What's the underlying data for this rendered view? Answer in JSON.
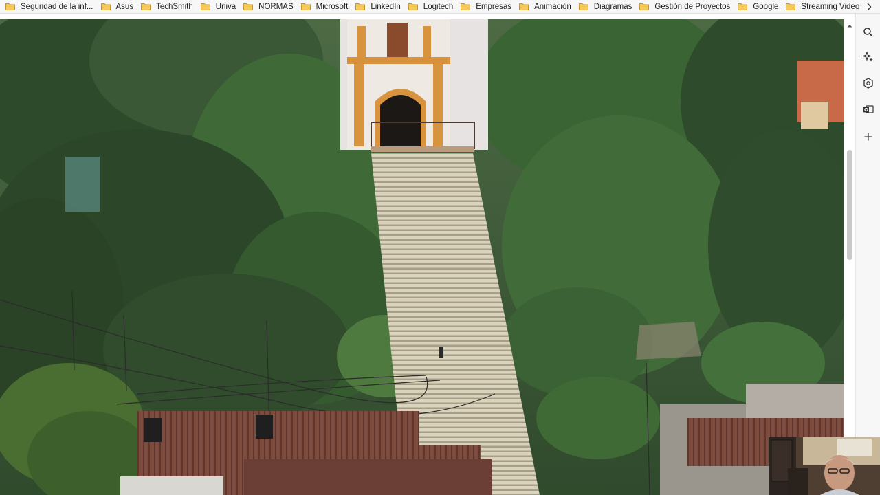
{
  "bookmarks": [
    {
      "label": "Seguridad de la inf..."
    },
    {
      "label": "Asus"
    },
    {
      "label": "TechSmith"
    },
    {
      "label": "Univa"
    },
    {
      "label": "NORMAS"
    },
    {
      "label": "Microsoft"
    },
    {
      "label": "LinkedIn"
    },
    {
      "label": "Logitech"
    },
    {
      "label": "Empresas"
    },
    {
      "label": "Animación"
    },
    {
      "label": "Diagramas"
    },
    {
      "label": "Gestión de Proyectos"
    },
    {
      "label": "Google"
    },
    {
      "label": "Streaming Video"
    }
  ],
  "bookmarks_overflow_icon": "chevron-right-icon",
  "side_panel_icons": [
    "search-icon",
    "sparkle-icon",
    "copilot-icon",
    "outlook-icon",
    "add-icon"
  ],
  "colors": {
    "folder": "#e8b64a",
    "bar_bg": "#f7f7f7",
    "scroll_thumb": "#c9c9c9"
  }
}
